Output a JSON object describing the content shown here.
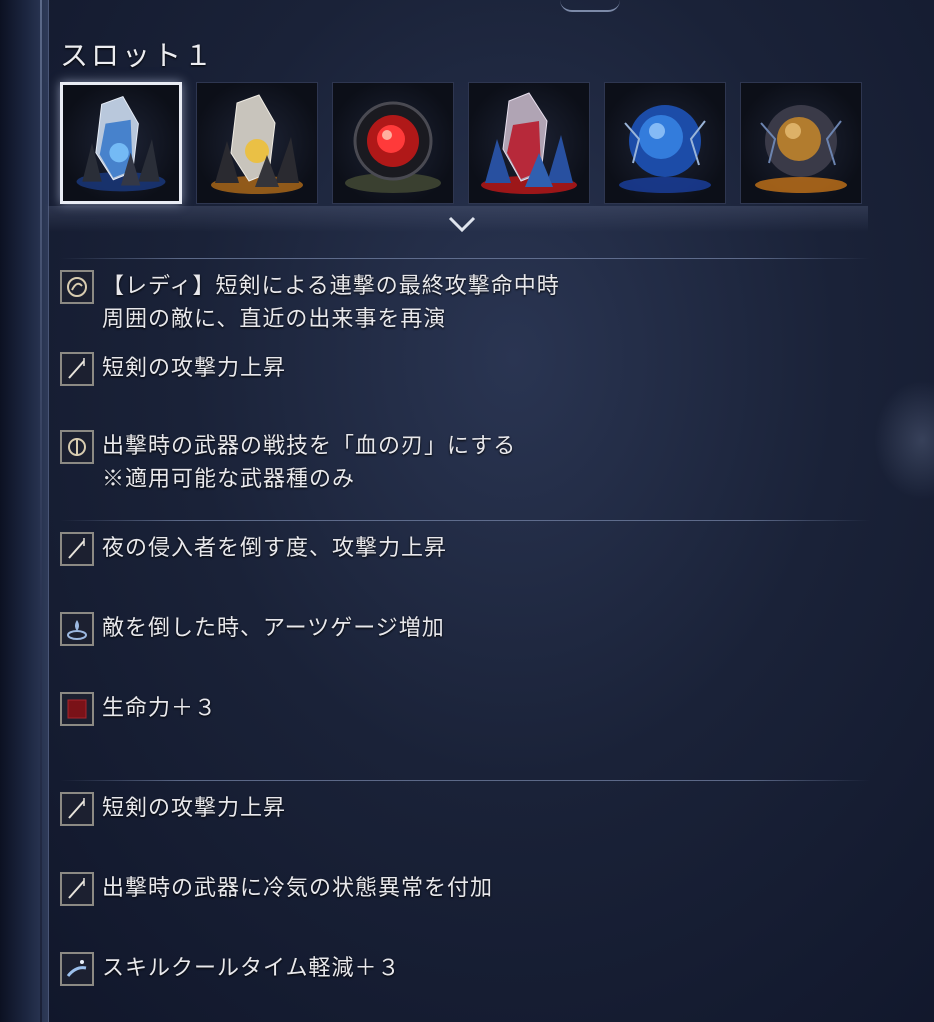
{
  "slot": {
    "title": "スロット１"
  },
  "gems": [
    {
      "name": "blue-crystal-relic",
      "color": "#3a8ad8"
    },
    {
      "name": "yellow-crystal-relic",
      "color": "#e0b030"
    },
    {
      "name": "red-orb-relic",
      "color": "#e02424"
    },
    {
      "name": "red-crystal-relic",
      "color": "#d02838"
    },
    {
      "name": "blue-orb-relic",
      "color": "#2a6ad0"
    },
    {
      "name": "orange-orb-relic",
      "color": "#d88a28"
    }
  ],
  "effects": [
    {
      "icon": "lady-skill-icon",
      "line1": "【レディ】短剣による連撃の最終攻撃命中時",
      "line2": "周囲の敵に、直近の出来事を再演"
    },
    {
      "icon": "sword-attack-icon",
      "line1": "短剣の攻撃力上昇"
    },
    {
      "icon": "weapon-skill-icon",
      "line1": "出撃時の武器の戦技を「血の刃」にする",
      "line2": "※適用可能な武器種のみ"
    },
    {
      "icon": "sword-attack-icon",
      "line1": "夜の侵入者を倒す度、攻撃力上昇"
    },
    {
      "icon": "arts-gauge-icon",
      "line1": "敵を倒した時、アーツゲージ増加"
    },
    {
      "icon": "vigor-stat-icon",
      "line1": "生命力＋３"
    },
    {
      "icon": "sword-attack-icon",
      "line1": "短剣の攻撃力上昇"
    },
    {
      "icon": "sword-attack-icon",
      "line1": "出撃時の武器に冷気の状態異常を付加"
    },
    {
      "icon": "skill-cooldown-icon",
      "line1": "スキルクールタイム軽減＋３"
    }
  ]
}
